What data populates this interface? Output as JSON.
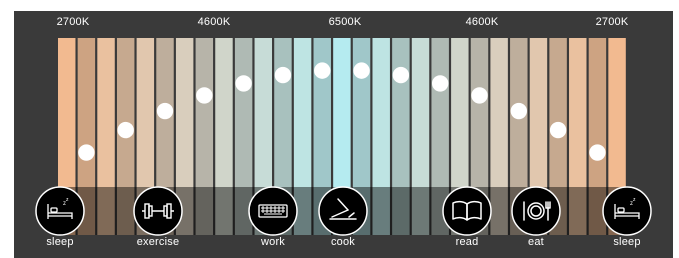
{
  "temperature_labels": [
    "2700K",
    "4600K",
    "6500K",
    "4600K",
    "2700K"
  ],
  "activities": [
    {
      "label": "sleep",
      "icon": "bed-icon"
    },
    {
      "label": "exercise",
      "icon": "dumbbell-icon"
    },
    {
      "label": "work",
      "icon": "keyboard-icon"
    },
    {
      "label": "cook",
      "icon": "pan-icon"
    },
    {
      "label": "read",
      "icon": "book-icon"
    },
    {
      "label": "eat",
      "icon": "plate-icon"
    },
    {
      "label": "sleep",
      "icon": "bed-icon"
    }
  ],
  "colors": {
    "background": "#3a3a3a",
    "warm_2700K": "#f2ba90",
    "neutral_4600K": "#d5d1c4",
    "cool_6500K": "#b5ebf0",
    "dot": "#ffffff",
    "icon_circle": "#000000"
  }
}
